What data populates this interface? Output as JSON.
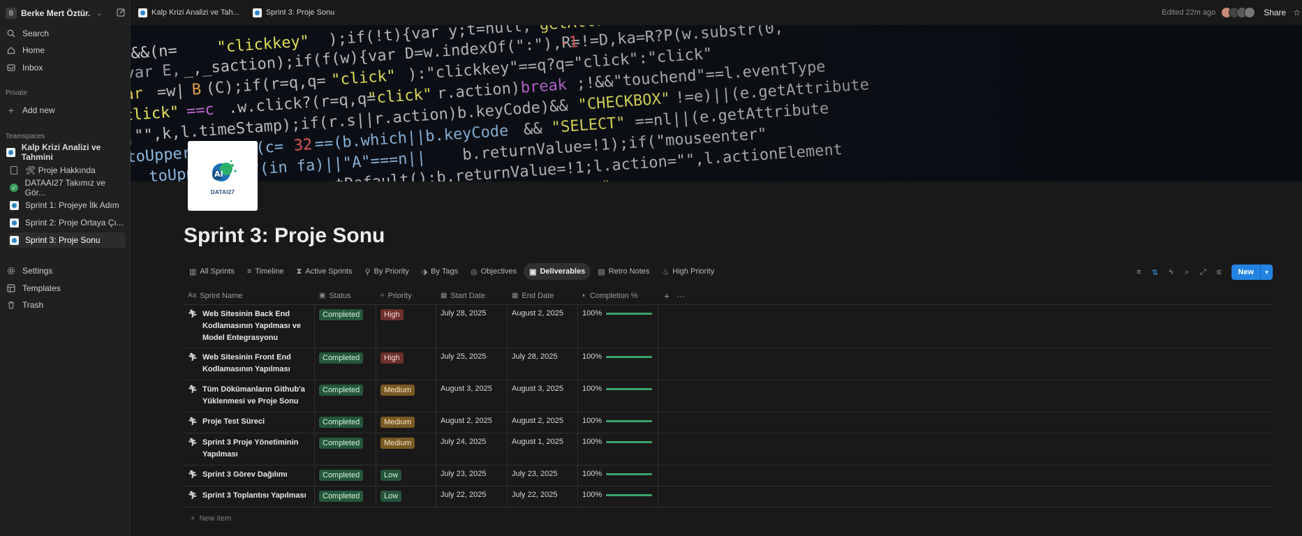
{
  "workspace": {
    "badge": "B",
    "name": "Berke Mert Öztür..."
  },
  "sidebar": {
    "nav": [
      {
        "label": "Search",
        "icon": "search-icon"
      },
      {
        "label": "Home",
        "icon": "home-icon"
      },
      {
        "label": "Inbox",
        "icon": "inbox-icon"
      }
    ],
    "private_label": "Private",
    "add_new": "Add new",
    "teamspaces_label": "Teamspaces",
    "teamspace": "Kalp Krizi Analizi ve Tahmini",
    "pages": [
      {
        "label": "🛠 Proje Hakkında",
        "icon": "doc-icon"
      },
      {
        "label": "DATAAI27 Takımız ve Gör...",
        "icon": "check-circle-icon"
      },
      {
        "label": "Sprint 1: Projeye İlk Adım",
        "icon": "page-icon"
      },
      {
        "label": "Sprint 2: Proje Ortaya Çı...",
        "icon": "page-icon"
      },
      {
        "label": "Sprint 3: Proje Sonu",
        "icon": "page-icon"
      }
    ],
    "bottom": [
      {
        "label": "Settings",
        "icon": "gear-icon"
      },
      {
        "label": "Templates",
        "icon": "templates-icon"
      },
      {
        "label": "Trash",
        "icon": "trash-icon"
      }
    ]
  },
  "topbar": {
    "breadcrumbs": [
      "Kalp Krizi Analizi ve Tah...",
      "Sprint 3: Proje Sonu"
    ],
    "edited": "Edited 22m ago",
    "share": "Share"
  },
  "logo": {
    "text": "DATAI27"
  },
  "page": {
    "title": "Sprint 3: Proje Sonu"
  },
  "views": [
    {
      "label": "All Sprints",
      "icon": "▥"
    },
    {
      "label": "Timeline",
      "icon": "≡"
    },
    {
      "label": "Active Sprints",
      "icon": "⧗"
    },
    {
      "label": "By Priority",
      "icon": "⚲"
    },
    {
      "label": "By Tags",
      "icon": "⬗"
    },
    {
      "label": "Objectives",
      "icon": "◎"
    },
    {
      "label": "Deliverables",
      "icon": "▣"
    },
    {
      "label": "Retro Notes",
      "icon": "▤"
    },
    {
      "label": "High Priority",
      "icon": "♨"
    }
  ],
  "toolbar": {
    "new_label": "New"
  },
  "columns": [
    {
      "label": "Sprint Name",
      "icon": "Aa"
    },
    {
      "label": "Status",
      "icon": "▣"
    },
    {
      "label": "Priority",
      "icon": "≈"
    },
    {
      "label": "Start Date",
      "icon": "▦"
    },
    {
      "label": "End Date",
      "icon": "▦"
    },
    {
      "label": "Completion %",
      "icon": "◐"
    }
  ],
  "rows": [
    {
      "name": "Web Sitesinin Back End Kodlamasının Yapılması ve Model Entegrasyonu",
      "status": "Completed",
      "priority": "High",
      "start": "July 28, 2025",
      "end": "August 2, 2025",
      "completion": "100%",
      "progress": 1.0
    },
    {
      "name": "Web Sitesinin Front End Kodlamasının Yapılması",
      "status": "Completed",
      "priority": "High",
      "start": "July 25, 2025",
      "end": "July 28, 2025",
      "completion": "100%",
      "progress": 1.0
    },
    {
      "name": "Tüm Dökümanların Github'a Yüklenmesi ve Proje Sonu",
      "status": "Completed",
      "priority": "Medium",
      "start": "August 3, 2025",
      "end": "August 3, 2025",
      "completion": "100%",
      "progress": 1.0
    },
    {
      "name": "Proje Test Süreci",
      "status": "Completed",
      "priority": "Medium",
      "start": "August 2, 2025",
      "end": "August 2, 2025",
      "completion": "100%",
      "progress": 1.0
    },
    {
      "name": "Sprint 3 Proje Yönetiminin Yapılması",
      "status": "Completed",
      "priority": "Medium",
      "start": "July 24, 2025",
      "end": "August 1, 2025",
      "completion": "100%",
      "progress": 1.0
    },
    {
      "name": "Sprint 3 Görev Dağılımı",
      "status": "Completed",
      "priority": "Low",
      "start": "July 23, 2025",
      "end": "July 23, 2025",
      "completion": "100%",
      "progress": 1.0
    },
    {
      "name": "Sprint 3 Toplantısı Yapılması",
      "status": "Completed",
      "priority": "Low",
      "start": "July 22, 2025",
      "end": "July 22, 2025",
      "completion": "100%",
      "progress": 1.0
    }
  ],
  "new_item": "New item",
  "colors": {
    "accent": "#2383e2",
    "completed": "#24573b",
    "high": "#6e2f2f",
    "medium": "#7a5a24",
    "low": "#25543a",
    "progress": "#3aa46a"
  }
}
